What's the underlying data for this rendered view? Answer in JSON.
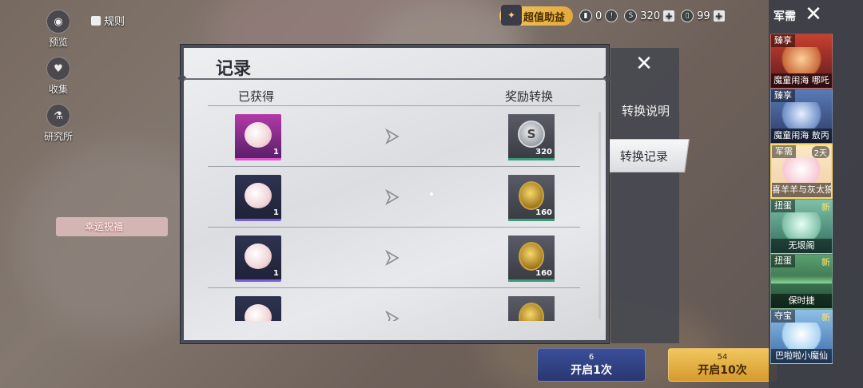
{
  "left_nav": [
    {
      "label": "预览",
      "icon": "eye-icon"
    },
    {
      "label": "收集",
      "icon": "heart-icon"
    },
    {
      "label": "研究所",
      "icon": "lab-icon"
    }
  ],
  "rules_label": "规则",
  "topbar": {
    "recharge_label": "超值助益",
    "currencies": [
      {
        "value": "0",
        "icon": "ticket-icon"
      },
      {
        "value": "320",
        "icon": "silver-coin-icon"
      },
      {
        "value": "99",
        "icon": "card-icon"
      }
    ]
  },
  "luck_tag": "幸运祝福",
  "bottom": {
    "open_once": {
      "cost": "6",
      "label": "开启1次"
    },
    "open_ten": {
      "cost": "54",
      "label": "开启10次"
    }
  },
  "sidebar": {
    "title": "军需",
    "cards": [
      {
        "tag": "臻享",
        "name": "魔童闹海 哪吒",
        "extra": ""
      },
      {
        "tag": "臻享",
        "name": "魔童闹海 敖丙",
        "extra": ""
      },
      {
        "tag": "军需",
        "name": "喜羊羊与灰太狼",
        "extra": "2天"
      },
      {
        "tag": "扭蛋",
        "name": "无垠阁",
        "extra": "新"
      },
      {
        "tag": "扭蛋",
        "name": "保时捷",
        "extra": "新"
      },
      {
        "tag": "夺宝",
        "name": "巴啦啦小魔仙",
        "extra": "新"
      }
    ]
  },
  "dialog": {
    "title": "记录",
    "col_obtained": "已获得",
    "col_reward": "奖励转换",
    "rows": [
      {
        "item_qty": "1",
        "reward_qty": "320",
        "item_style": "pink",
        "reward_kind": "silver"
      },
      {
        "item_qty": "1",
        "reward_qty": "160",
        "item_style": "purple",
        "reward_kind": "gold"
      },
      {
        "item_qty": "1",
        "reward_qty": "160",
        "item_style": "purple",
        "reward_kind": "gold"
      },
      {
        "item_qty": "",
        "reward_qty": "",
        "item_style": "purple",
        "reward_kind": "gold"
      }
    ]
  },
  "side_tabs": {
    "explain": "转换说明",
    "records": "转换记录"
  },
  "colors": {
    "accent_gold": "#f0c75e",
    "panel": "#4a4d55"
  }
}
